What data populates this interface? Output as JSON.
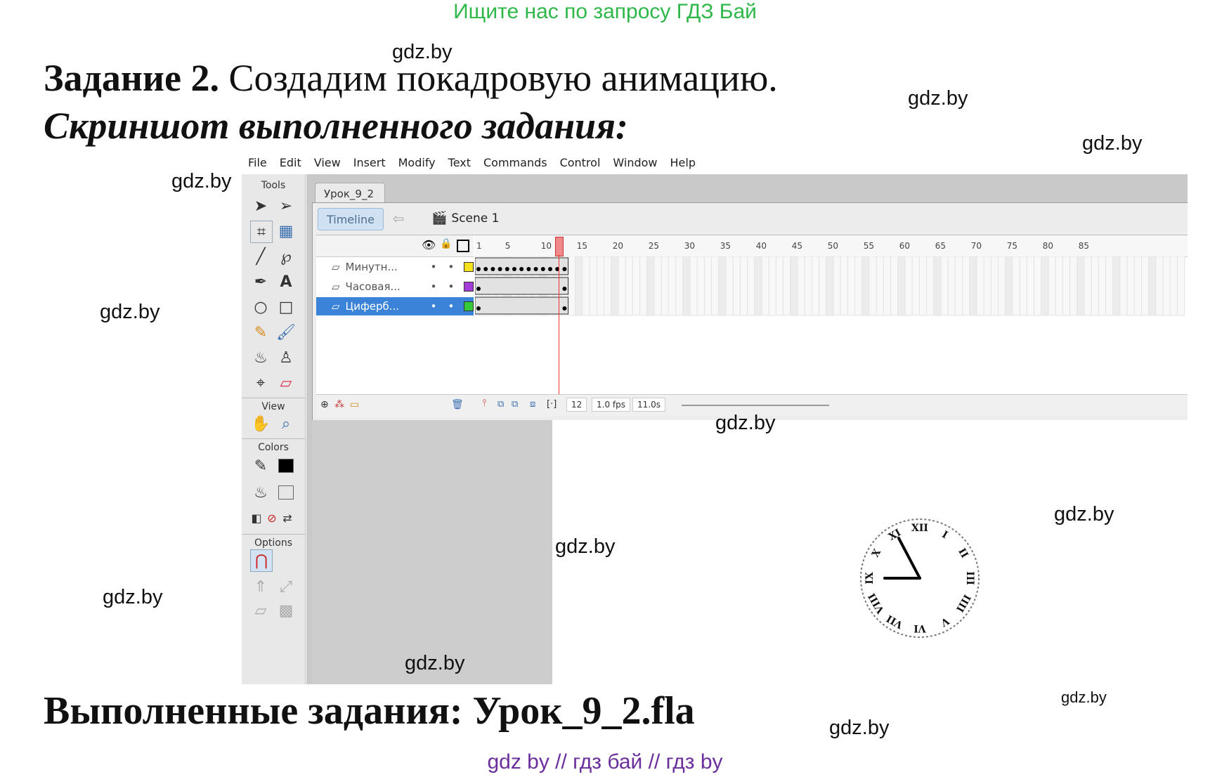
{
  "top_link": "Ищите нас по запросу ГДЗ Бай",
  "watermark": "gdz.by",
  "heading": {
    "task_bold": "Задание 2.",
    "task_text": "Создадим покадровую анимацию.",
    "screenshot_label": "Скриншот выполненного задания:",
    "completed": "Выполненные задания: Урок_9_2.fla"
  },
  "footer": "gdz by  //  гдз бай  //  гдз by",
  "flash": {
    "menu": [
      "File",
      "Edit",
      "View",
      "Insert",
      "Modify",
      "Text",
      "Commands",
      "Control",
      "Window",
      "Help"
    ],
    "tools_title": "Tools",
    "view_title": "View",
    "colors_title": "Colors",
    "options_title": "Options",
    "doc_tab": "Урок_9_2",
    "timeline_button": "Timeline",
    "scene_label": "Scene 1",
    "layers": [
      {
        "name": "Минутн...",
        "color": "#f5e21c"
      },
      {
        "name": "Часовая...",
        "color": "#a33bd6"
      },
      {
        "name": "Циферб...",
        "color": "#35c93b"
      }
    ],
    "ruler_ticks": [
      "1",
      "5",
      "10",
      "15",
      "20",
      "25",
      "30",
      "35",
      "40",
      "45",
      "50",
      "55",
      "60",
      "65",
      "70",
      "75",
      "80",
      "85"
    ],
    "current_frame": "12",
    "frame_rate": "1.0 fps",
    "elapsed": "11.0s",
    "clock_numerals": [
      "XII",
      "I",
      "II",
      "III",
      "IIII",
      "V",
      "VI",
      "VII",
      "VIII",
      "IX",
      "X",
      "XI"
    ]
  }
}
